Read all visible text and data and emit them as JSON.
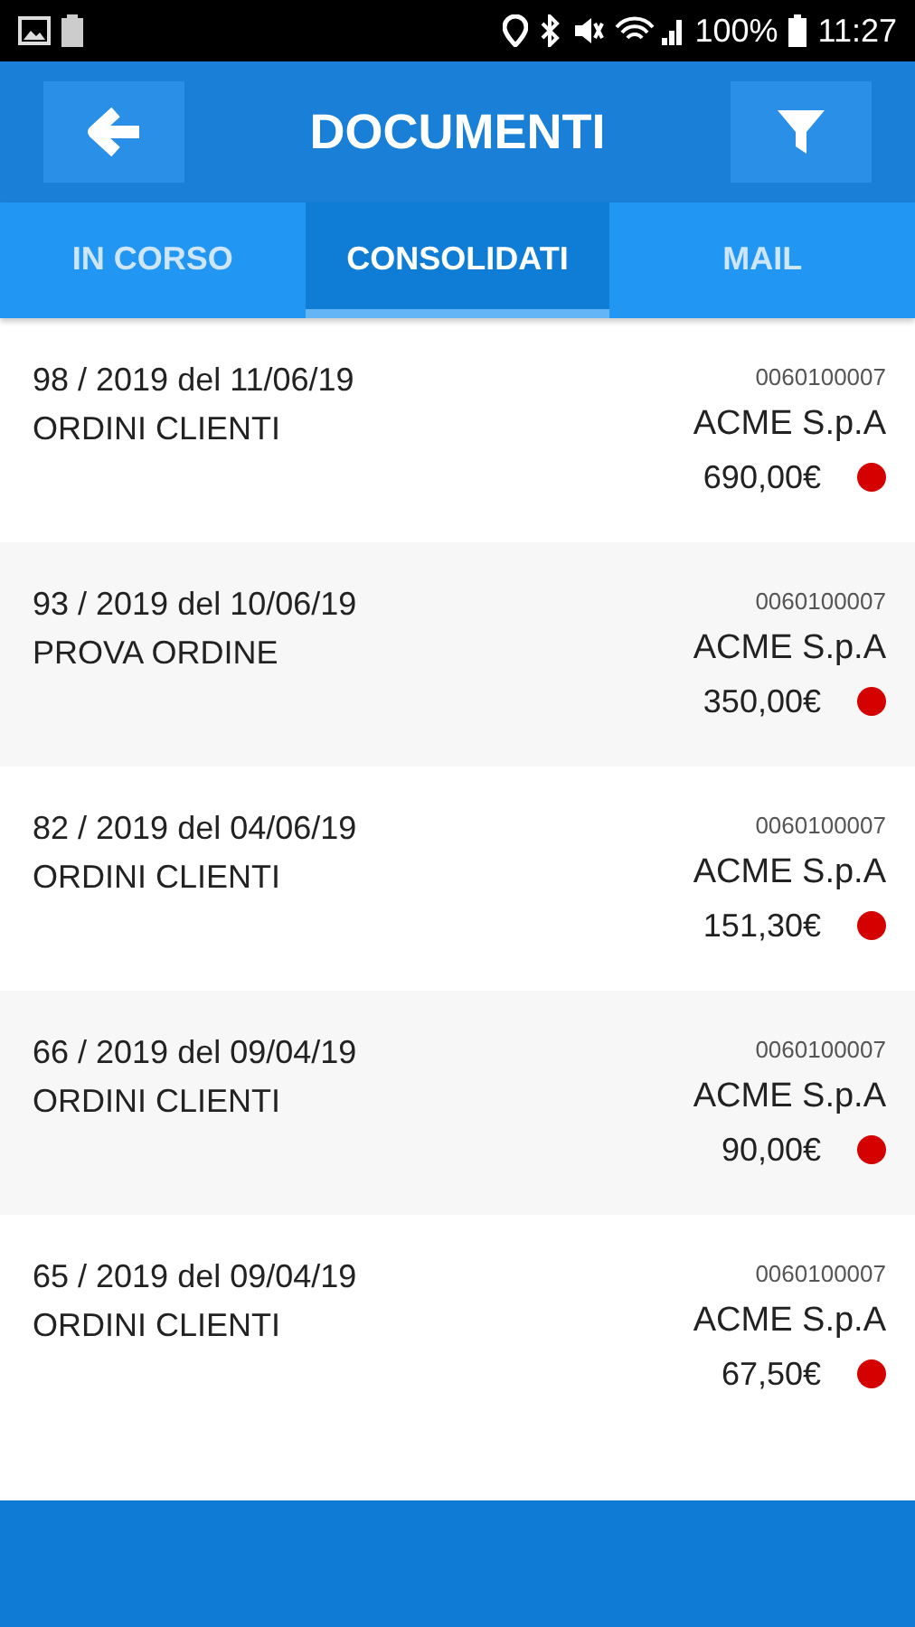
{
  "status_bar": {
    "battery": "100%",
    "time": "11:27"
  },
  "header": {
    "title": "DOCUMENTI"
  },
  "tabs": [
    {
      "label": "IN CORSO",
      "selected": false
    },
    {
      "label": "CONSOLIDATI",
      "selected": true
    },
    {
      "label": "MAIL",
      "selected": false
    }
  ],
  "documents": [
    {
      "number": "98 / 2019 del 11/06/19",
      "type": "ORDINI CLIENTI",
      "code": "0060100007",
      "customer": "ACME S.p.A",
      "amount": "690,00€",
      "color": "#d50000"
    },
    {
      "number": "93 / 2019 del 10/06/19",
      "type": "PROVA ORDINE",
      "code": "0060100007",
      "customer": "ACME S.p.A",
      "amount": "350,00€",
      "color": "#d50000"
    },
    {
      "number": "82 / 2019 del 04/06/19",
      "type": "ORDINI CLIENTI",
      "code": "0060100007",
      "customer": "ACME S.p.A",
      "amount": "151,30€",
      "color": "#d50000"
    },
    {
      "number": "66 / 2019 del 09/04/19",
      "type": "ORDINI CLIENTI",
      "code": "0060100007",
      "customer": "ACME S.p.A",
      "amount": "90,00€",
      "color": "#d50000"
    },
    {
      "number": "65 / 2019 del 09/04/19",
      "type": "ORDINI CLIENTI",
      "code": "0060100007",
      "customer": "ACME S.p.A",
      "amount": "67,50€",
      "color": "#d50000"
    }
  ]
}
